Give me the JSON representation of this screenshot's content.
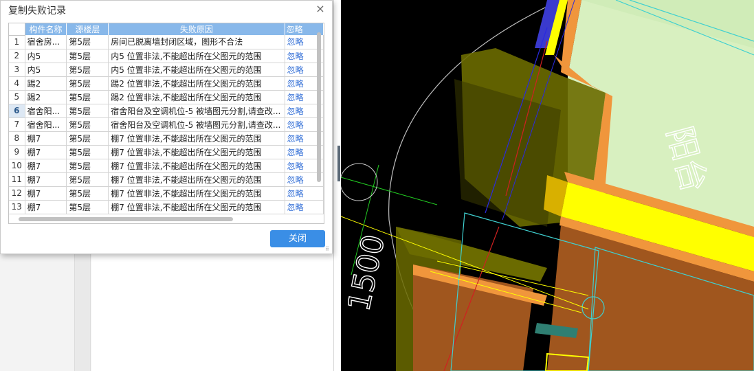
{
  "dialog": {
    "title": "复制失败记录",
    "close_icon": "×",
    "close_button": "关闭",
    "columns": [
      "构件名称",
      "源楼层",
      "失败原因",
      "忽略"
    ],
    "selected_row": 6,
    "rows": [
      {
        "num": "1",
        "name": "宿舍房...",
        "floor": "第5层",
        "reason": "房间已脱离墙封闭区域，图形不合法",
        "action": "忽略"
      },
      {
        "num": "2",
        "name": "内5",
        "floor": "第5层",
        "reason": "内5 位置非法,不能超出所在父图元的范围",
        "action": "忽略"
      },
      {
        "num": "3",
        "name": "内5",
        "floor": "第5层",
        "reason": "内5 位置非法,不能超出所在父图元的范围",
        "action": "忽略"
      },
      {
        "num": "4",
        "name": "踢2",
        "floor": "第5层",
        "reason": "踢2 位置非法,不能超出所在父图元的范围",
        "action": "忽略"
      },
      {
        "num": "5",
        "name": "踢2",
        "floor": "第5层",
        "reason": "踢2 位置非法,不能超出所在父图元的范围",
        "action": "忽略"
      },
      {
        "num": "6",
        "name": "宿舍阳...",
        "floor": "第5层",
        "reason": "宿舍阳台及空调机位-5 被墙图元分割,请查改...",
        "action": "忽略"
      },
      {
        "num": "7",
        "name": "宿舍阳...",
        "floor": "第5层",
        "reason": "宿舍阳台及空调机位-5 被墙图元分割,请查改...",
        "action": "忽略"
      },
      {
        "num": "8",
        "name": "棚7",
        "floor": "第5层",
        "reason": "棚7 位置非法,不能超出所在父图元的范围",
        "action": "忽略"
      },
      {
        "num": "9",
        "name": "棚7",
        "floor": "第5层",
        "reason": "棚7 位置非法,不能超出所在父图元的范围",
        "action": "忽略"
      },
      {
        "num": "10",
        "name": "棚7",
        "floor": "第5层",
        "reason": "棚7 位置非法,不能超出所在父图元的范围",
        "action": "忽略"
      },
      {
        "num": "11",
        "name": "棚7",
        "floor": "第5层",
        "reason": "棚7 位置非法,不能超出所在父图元的范围",
        "action": "忽略"
      },
      {
        "num": "12",
        "name": "棚7",
        "floor": "第5层",
        "reason": "棚7 位置非法,不能超出所在父图元的范围",
        "action": "忽略"
      },
      {
        "num": "13",
        "name": "棚7",
        "floor": "第5层",
        "reason": "棚7 位置非法,不能超出所在父图元的范围",
        "action": "忽略"
      }
    ]
  },
  "viewport": {
    "dimension_text": "1500",
    "room_label": "阳台",
    "colors": {
      "background": "#000000",
      "wall_orange": "#f0963c",
      "wall_brown": "#a0561e",
      "olive": "#6b6b00",
      "room_fill": "#d8f0c0",
      "yellow": "#ffff00",
      "blue": "#3a3acd",
      "cyan": "#3fd0d0"
    }
  },
  "icons": {
    "close": "close-icon",
    "resize": "resize-grip-icon"
  }
}
